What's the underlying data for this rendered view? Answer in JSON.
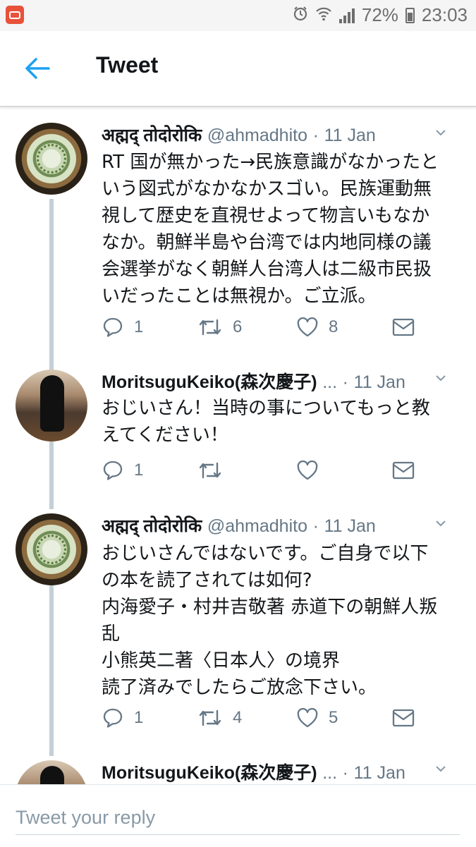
{
  "status": {
    "battery": "72%",
    "time": "23:03",
    "icons": [
      "app-notification-icon",
      "alarm-icon",
      "wifi-icon",
      "signal-icon",
      "battery-icon"
    ]
  },
  "header": {
    "title": "Tweet",
    "back_icon": "arrow-left-icon"
  },
  "tweets": [
    {
      "name": "अह्मद् तोदोरोकि",
      "handle": "@ahmadhito",
      "dot": "·",
      "date": "11 Jan",
      "text": "RT 国が無かった→民族意識がなかったと\nいう図式がなかなかスゴい。民族運動無\n視して歴史を直視せよって物言いもなか\nなか。朝鮮半島や台湾では内地同様の議\n会選挙がなく朝鮮人台湾人は二級市民扱\nいだったことは無視か。ご立派。",
      "replies": "1",
      "retweets": "6",
      "likes": "8"
    },
    {
      "name": "MoritsuguKeiko(森次慶子)",
      "ellipsis": "...",
      "dot": "·",
      "date": "11 Jan",
      "text": "おじいさん！当時の事についてもっと教\nえてください！",
      "replies": "1",
      "retweets": "",
      "likes": ""
    },
    {
      "name": "अह्मद् तोदोरोकि",
      "handle": "@ahmadhito",
      "dot": "·",
      "date": "11 Jan",
      "text": "おじいさんではないです。ご自身で以下\nの本を読了されては如何?\n内海愛子・村井吉敬著 赤道下の朝鮮人叛\n乱\n小熊英二著〈日本人〉の境界\n読了済みでしたらご放念下さい。",
      "replies": "1",
      "retweets": "4",
      "likes": "5"
    },
    {
      "name": "MoritsuguKeiko(森次慶子)",
      "ellipsis": "...",
      "dot": "·",
      "date": "11 Jan"
    }
  ],
  "reply": {
    "placeholder": "Tweet your reply"
  },
  "colors": {
    "accent": "#1da1f2",
    "secondary_text": "#657786",
    "thread_line": "#c4cfd6"
  }
}
